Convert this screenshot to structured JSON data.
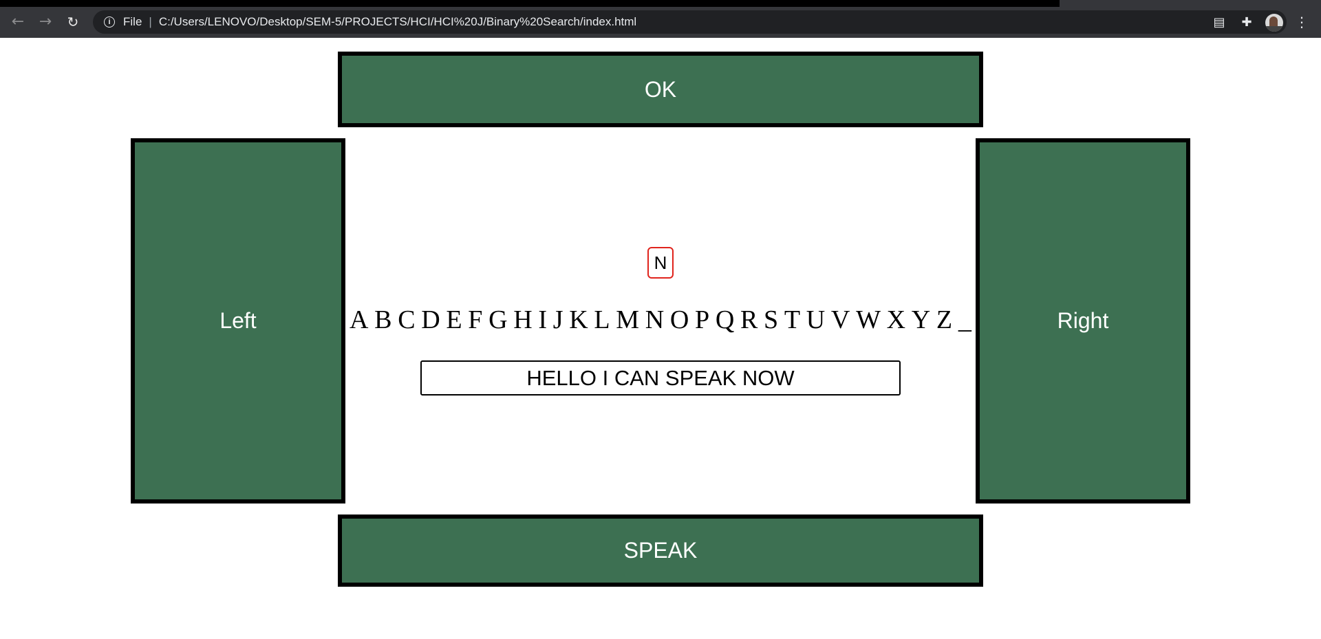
{
  "browser": {
    "scheme_label": "File",
    "url": "C:/Users/LENOVO/Desktop/SEM-5/PROJECTS/HCI/HCI%20J/Binary%20Search/index.html"
  },
  "page": {
    "ok_label": "OK",
    "left_label": "Left",
    "right_label": "Right",
    "speak_label": "SPEAK",
    "current_letter": "N",
    "letters": [
      "A",
      "B",
      "C",
      "D",
      "E",
      "F",
      "G",
      "H",
      "I",
      "J",
      "K",
      "L",
      "M",
      "N",
      "O",
      "P",
      "Q",
      "R",
      "S",
      "T",
      "U",
      "V",
      "W",
      "X",
      "Y",
      "Z",
      "_"
    ],
    "text_value": "HELLO I CAN SPEAK NOW"
  },
  "colors": {
    "panel_green": "#3d7052",
    "highlight_red": "#e0231c"
  }
}
